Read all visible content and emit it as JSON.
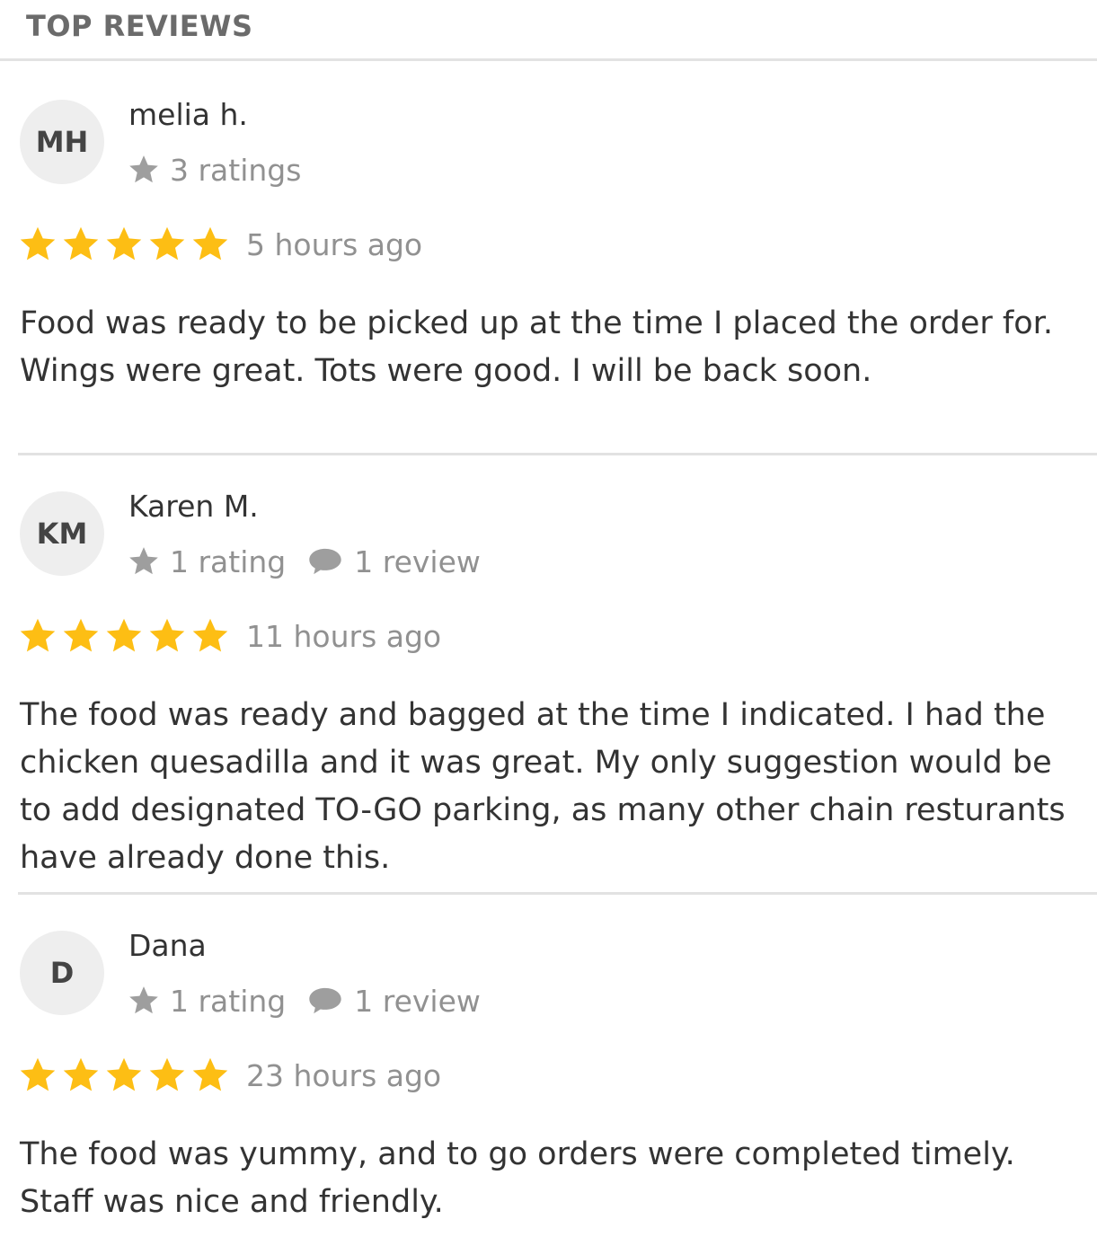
{
  "section": {
    "title": "TOP REVIEWS"
  },
  "colors": {
    "star_filled": "#FDBE14",
    "meta_icon": "#9E9E9E",
    "divider": "#E2E2E2",
    "avatar_bg": "#EEEEEE"
  },
  "icons": {
    "rating": "star-icon",
    "review_count": "speech-bubble-icon"
  },
  "reviews": [
    {
      "initials": "MH",
      "name": "melia h.",
      "ratings_count": "3 ratings",
      "review_count": "",
      "stars": 5,
      "time_ago": "5 hours ago",
      "text": "Food was ready to be picked up at the time I placed the order for. Wings were great. Tots were good. I will be back soon."
    },
    {
      "initials": "KM",
      "name": "Karen M.",
      "ratings_count": "1 rating",
      "review_count": "1 review",
      "stars": 5,
      "time_ago": "11 hours ago",
      "text": "The food was ready and bagged at the time I indicated. I had the chicken quesadilla and it was great. My only suggestion would be to add designated TO-GO parking, as many other chain resturants have already done this."
    },
    {
      "initials": "D",
      "name": "Dana",
      "ratings_count": "1 rating",
      "review_count": "1 review",
      "stars": 5,
      "time_ago": "23 hours ago",
      "text": "The food was yummy, and to go orders were completed timely. Staff was nice and friendly."
    }
  ]
}
